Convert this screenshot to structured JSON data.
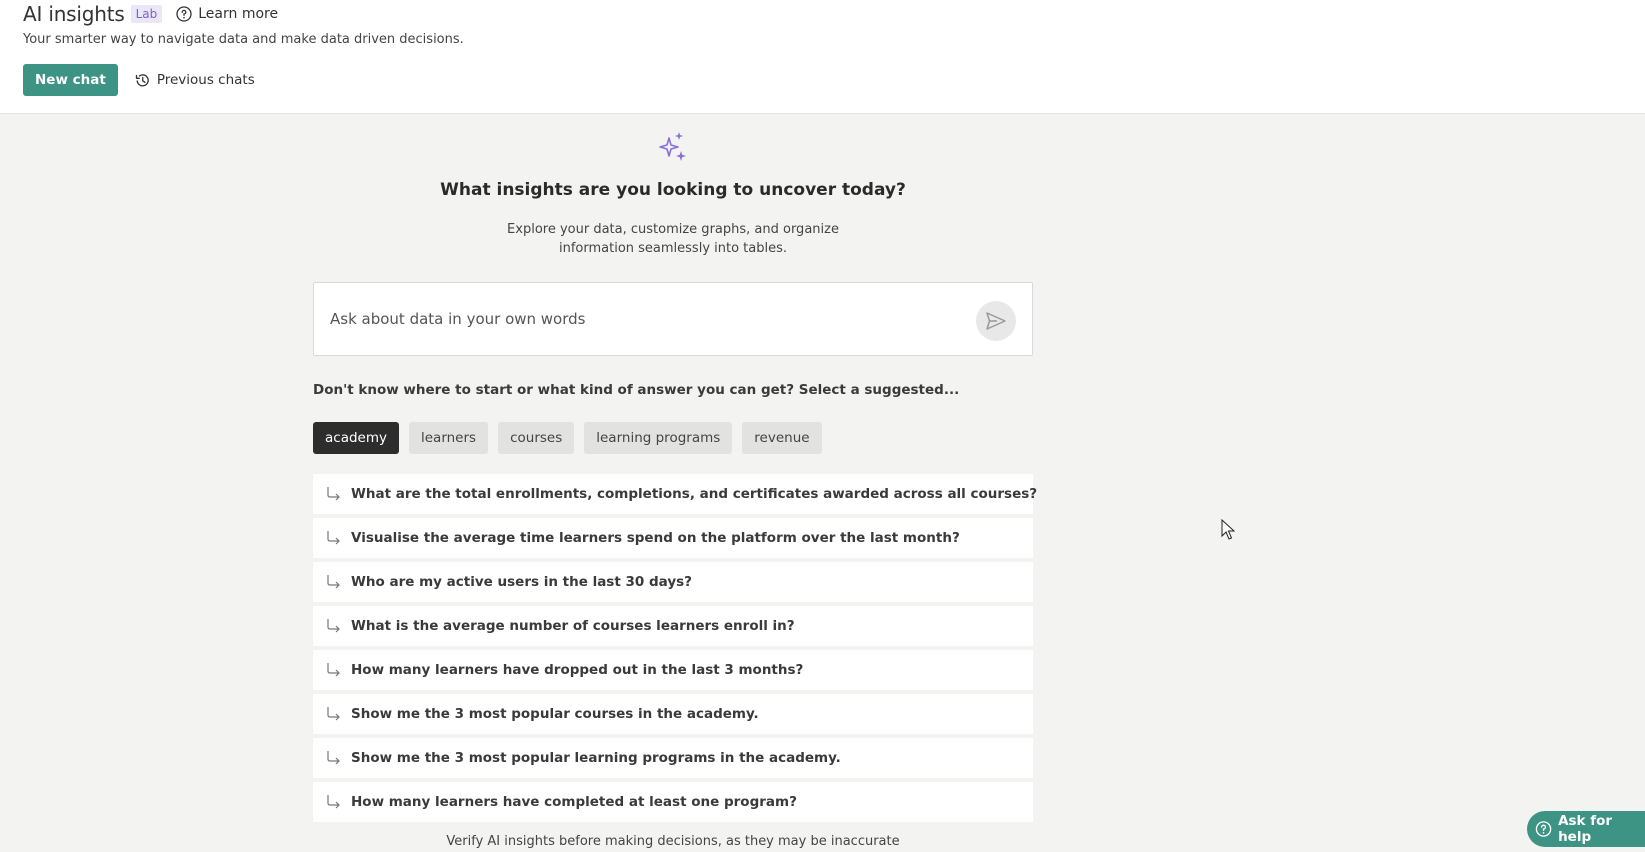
{
  "header": {
    "title": "AI insights",
    "badge": "Lab",
    "learn_more": "Learn more",
    "subtitle": "Your smarter way to navigate data and make data driven decisions.",
    "new_chat": "New chat",
    "previous_chats": "Previous chats"
  },
  "main": {
    "heading": "What insights are you looking to uncover today?",
    "description": "Explore your data, customize graphs, and organize information seamlessly into tables.",
    "search_placeholder": "Ask about data in your own words",
    "hint": "Don't know where to start or what kind of answer you can get? Select a suggested...",
    "chips": [
      "academy",
      "learners",
      "courses",
      "learning programs",
      "revenue"
    ],
    "active_chip": "academy",
    "suggestions": [
      "What are the total enrollments, completions, and certificates awarded across all courses?",
      "Visualise the average time learners spend on the platform over the last month?",
      "Who are my active users in the last 30 days?",
      "What is the average number of courses learners enroll in?",
      "How many learners have dropped out in the last 3 months?",
      "Show me the 3 most popular courses in the academy.",
      "Show me the 3 most popular learning programs in the academy.",
      "How many learners have completed at least one program?"
    ],
    "disclaimer": "Verify AI insights before making decisions, as they may be inaccurate"
  },
  "help": {
    "label": "Ask for help"
  },
  "colors": {
    "accent": "#3d9384",
    "sparkle": "#8a6fd6",
    "badge_bg": "#ece6f9",
    "page_bg": "#f3f3f2"
  }
}
